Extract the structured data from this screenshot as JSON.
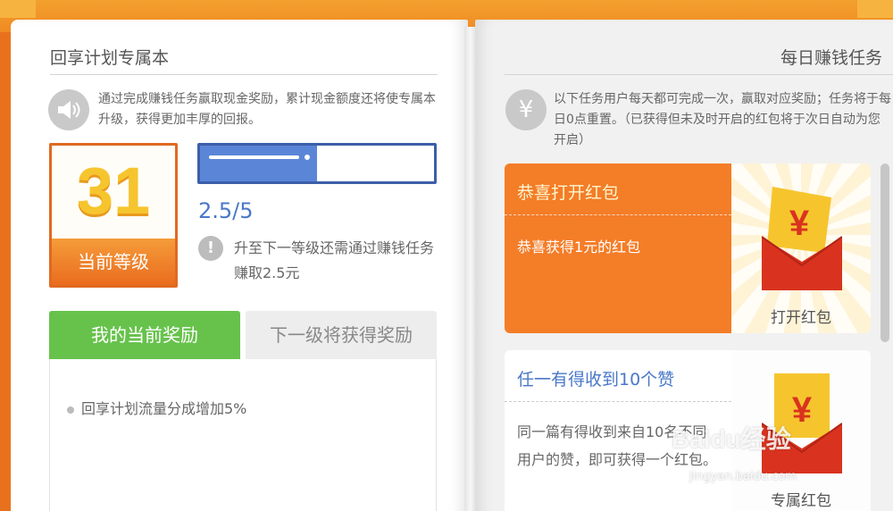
{
  "left_page": {
    "title": "回享计划专属本",
    "intro": "通过完成赚钱任务赢取现金奖励，累计现金额度还将使专属本升级，获得更加丰厚的回报。",
    "level": {
      "number": "31",
      "label": "当前等级"
    },
    "progress": {
      "value_text": "2.5/5",
      "current": 2.5,
      "max": 5
    },
    "next_level_hint": "升至下一等级还需通过赚钱任务赚取2.5元",
    "tabs": {
      "current": "我的当前奖励",
      "next": "下一级将获得奖励"
    },
    "rewards": [
      "回享计划流量分成增加5%"
    ]
  },
  "right_page": {
    "title": "每日赚钱任务",
    "intro": "以下任务用户每天都可完成一次，赢取对应奖励；任务将于每日0点重置。（已获得但未及时开启的红包将于次日自动为您开启）",
    "tasks": [
      {
        "title": "恭喜打开红包",
        "description": "恭喜获得1元的红包",
        "action_label": "打开红包"
      },
      {
        "title": "任一有得收到10个赞",
        "description": "同一篇有得收到来自10名不同用户的赞，即可获得一个红包。",
        "action_label": "专属红包"
      }
    ]
  },
  "icons": {
    "speaker": "speaker-icon",
    "yen": "yen-icon",
    "warning": "exclamation-icon",
    "red_envelope": "red-envelope-icon"
  },
  "colors": {
    "accent_orange": "#f47d28",
    "level_gold": "#f6c52e",
    "progress_blue": "#5b86d8",
    "tab_green": "#67c24c",
    "link_blue": "#4a78c8"
  },
  "watermark": {
    "brand": "Baidu经验",
    "url": "jingyan.baidu.com"
  }
}
